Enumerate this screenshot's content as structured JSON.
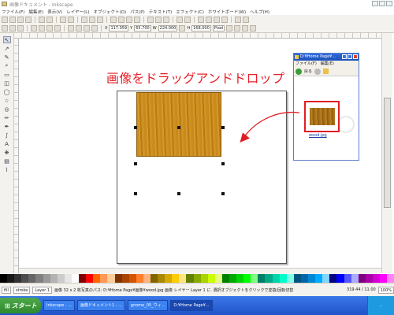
{
  "window": {
    "title": "画像ドキュメント - Inkscape"
  },
  "menubar": {
    "items": [
      "ファイル(F)",
      "編集(E)",
      "表示(V)",
      "レイヤー(L)",
      "オブジェクト(O)",
      "パス(P)",
      "テキスト(T)",
      "エフェクト(C)",
      "ホワイトボード(W)",
      "ヘルプ(H)"
    ]
  },
  "toolbar2": {
    "x_label": "X",
    "x_value": "117.059",
    "y_label": "Y",
    "y_value": "65.700",
    "w_label": "W",
    "w_value": "224.000",
    "h_label": "H",
    "h_value": "168.000",
    "unit": "Pixel"
  },
  "annotation": {
    "text": "画像をドラッグアンドドロップ"
  },
  "explorer": {
    "title": "D:¥Home Page¥...",
    "menu": "ファイル(F)　編集(E)",
    "back_label": "戻る",
    "thumb_label": "wood.jpg"
  },
  "palette": [
    "#000000",
    "#1a1a1a",
    "#333333",
    "#4d4d4d",
    "#666666",
    "#808080",
    "#999999",
    "#b3b3b3",
    "#cccccc",
    "#e6e6e6",
    "#ffffff",
    "#800000",
    "#ff0000",
    "#ff6600",
    "#ff9955",
    "#ffcc99",
    "#803300",
    "#aa4400",
    "#d45500",
    "#ff7f2a",
    "#ffb380",
    "#806600",
    "#aa8800",
    "#d4aa00",
    "#ffcc00",
    "#ffe680",
    "#668000",
    "#88aa00",
    "#aad400",
    "#ccff00",
    "#e5ff80",
    "#008000",
    "#00aa00",
    "#00d400",
    "#00ff00",
    "#80ff80",
    "#008066",
    "#00aa88",
    "#00d4aa",
    "#00ffcc",
    "#80ffe6",
    "#005580",
    "#0066aa",
    "#0088d4",
    "#00aaff",
    "#80d4ff",
    "#000080",
    "#0000ff",
    "#5555ff",
    "#aaaaff",
    "#800080",
    "#aa00aa",
    "#d400d4",
    "#ff00ff",
    "#ff80ff"
  ],
  "status": {
    "fill_label": "fill",
    "stroke_label": "stroke",
    "layer": "Layer 1",
    "message": "画像 32 x 2 枚写真のパス: D:¥Home Page¥画像¥wood.jpg 画像 レイヤー Layer 1 に. 選択オブジェクトをクリックで変換/回転切替",
    "coords": "319.44 / 11.00",
    "zoom": "100%"
  },
  "taskbar": {
    "start": "スタート",
    "tasks": [
      "Inkscape - ...",
      "画像ドキュメント1 - ...",
      "gnome_05_ウィ...",
      "D:¥Home Page¥..."
    ],
    "clock": "-"
  }
}
